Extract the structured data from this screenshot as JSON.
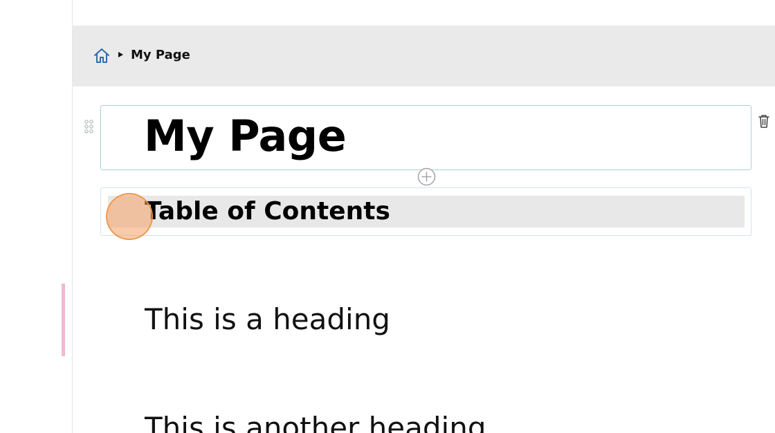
{
  "breadcrumb": {
    "home_icon": "home-icon",
    "current": "My Page"
  },
  "page": {
    "title": "My Page"
  },
  "blocks": {
    "toc_label": "Table of Contents",
    "headings": [
      "This is a heading",
      "This is another heading"
    ]
  },
  "icons": {
    "drag": "drag-handle-icon",
    "delete": "trash-icon",
    "add": "plus-circle-icon"
  },
  "colors": {
    "header_bg": "#eaeaea",
    "selected_block_border": "#a9cfd8",
    "home_icon": "#2b6cb0",
    "click_marker": "#f4a064",
    "rail_accent": "#f3b8cf"
  }
}
